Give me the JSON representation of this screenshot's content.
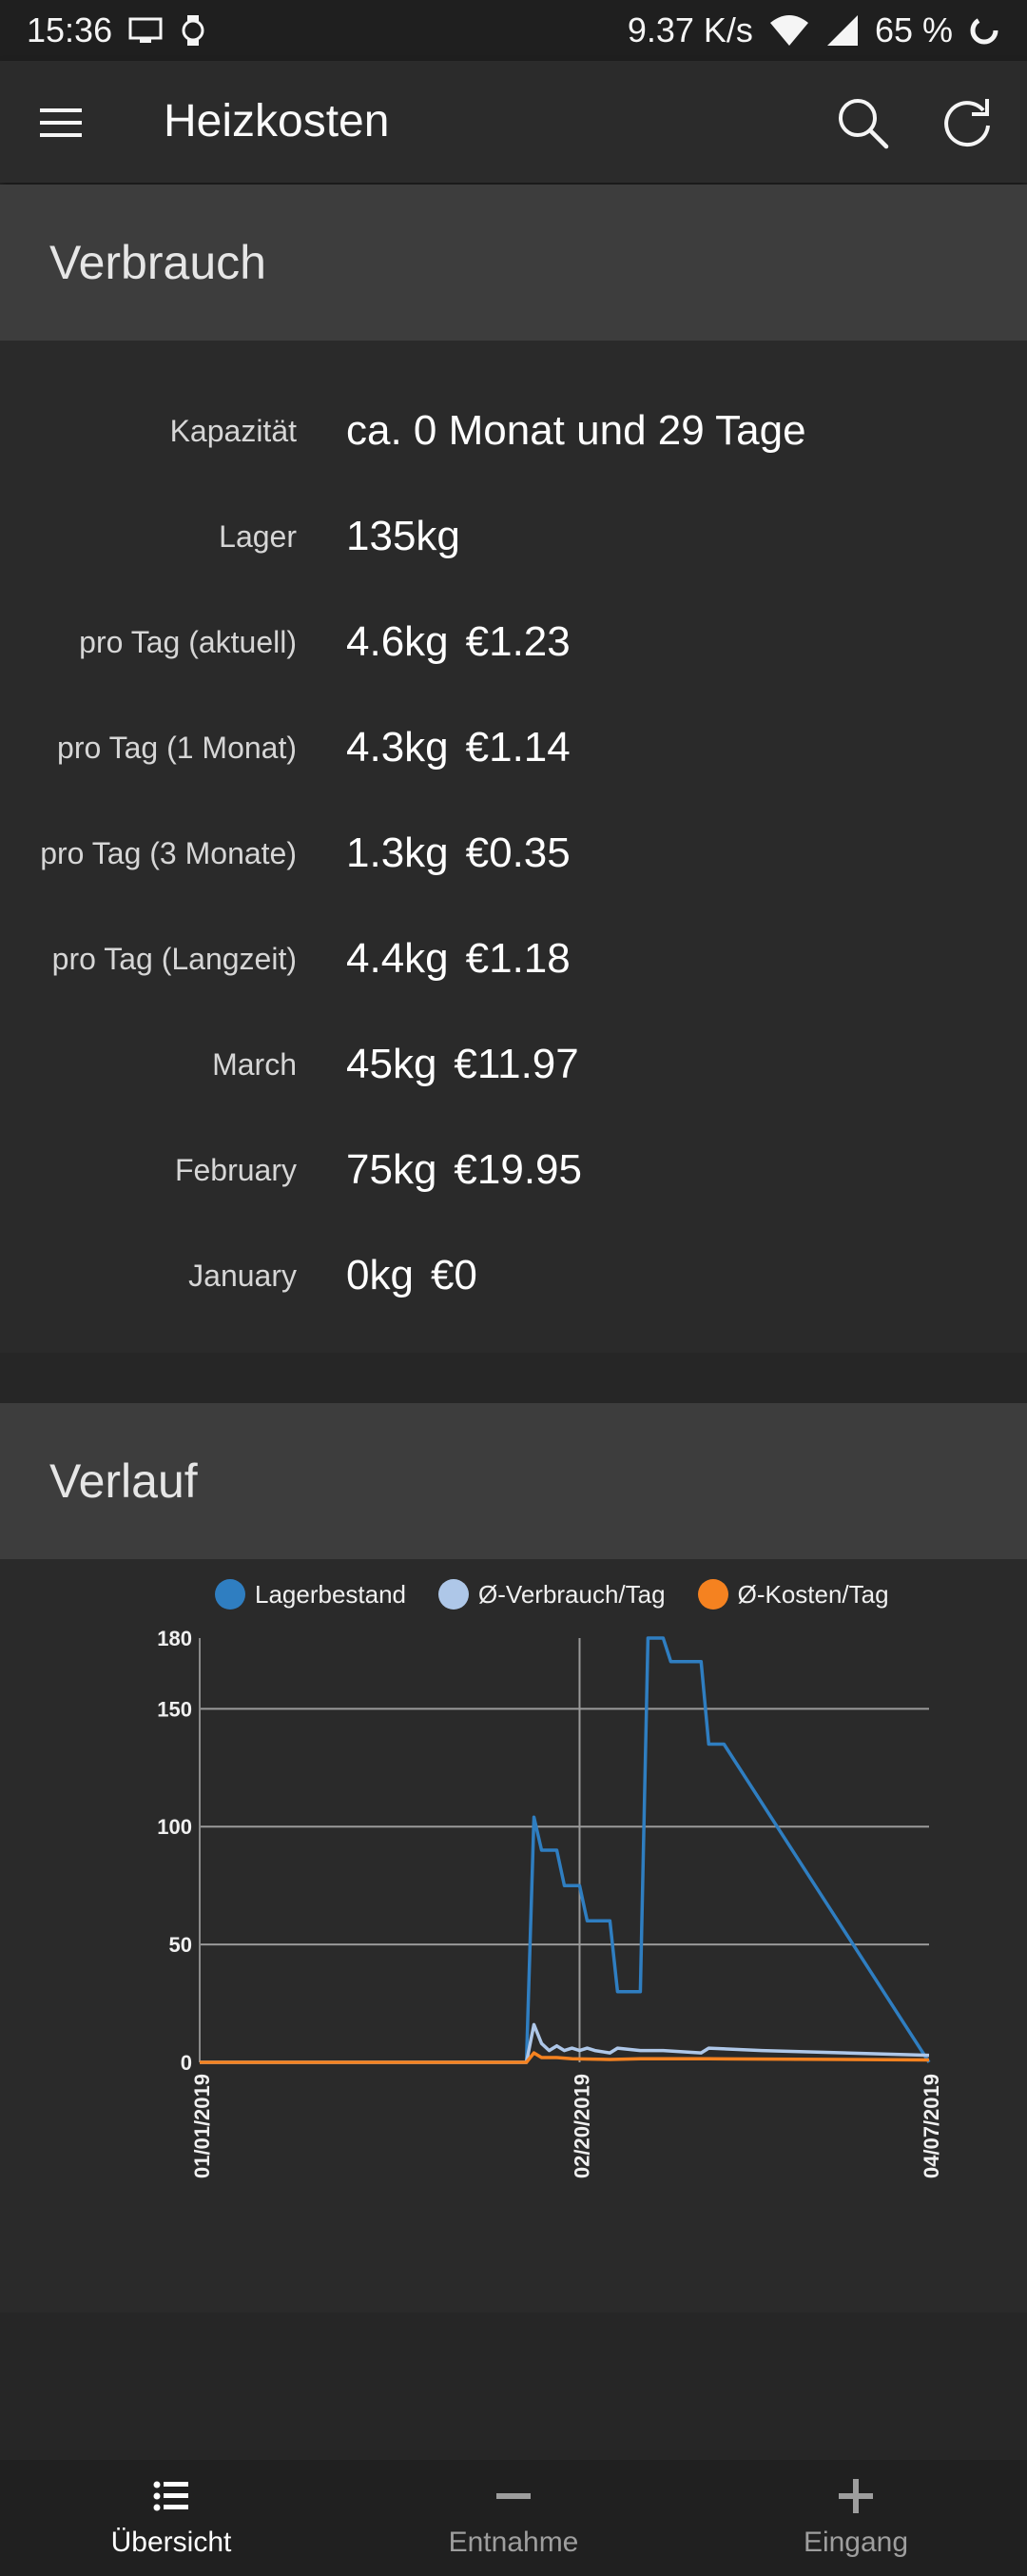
{
  "status_bar": {
    "time": "15:36",
    "speed": "9.37 K/s",
    "battery": "65 %"
  },
  "app_bar": {
    "title": "Heizkosten",
    "icons": [
      "menu-icon",
      "search-icon",
      "refresh-icon"
    ]
  },
  "verbrauch": {
    "title": "Verbrauch",
    "rows": [
      {
        "label": "Kapazität",
        "values": [
          "ca. 0 Monat und 29 Tage"
        ]
      },
      {
        "label": "Lager",
        "values": [
          "135kg"
        ]
      },
      {
        "label": "pro Tag (aktuell)",
        "values": [
          "4.6kg",
          "€1.23"
        ]
      },
      {
        "label": "pro Tag (1 Monat)",
        "values": [
          "4.3kg",
          "€1.14"
        ]
      },
      {
        "label": "pro Tag (3 Monate)",
        "values": [
          "1.3kg",
          "€0.35"
        ]
      },
      {
        "label": "pro Tag (Langzeit)",
        "values": [
          "4.4kg",
          "€1.18"
        ]
      },
      {
        "label": "March",
        "values": [
          "45kg",
          "€11.97"
        ]
      },
      {
        "label": "February",
        "values": [
          "75kg",
          "€19.95"
        ]
      },
      {
        "label": "January",
        "values": [
          "0kg",
          "€0"
        ]
      }
    ]
  },
  "verlauf": {
    "title": "Verlauf"
  },
  "chart_data": {
    "type": "line",
    "title": "",
    "xlabel": "",
    "ylabel": "",
    "ylim": [
      0,
      180
    ],
    "y_ticks": [
      "0",
      "50",
      "100",
      "150",
      "180"
    ],
    "x_ticks": [
      "01/01/2019",
      "02/20/2019",
      "04/07/2019"
    ],
    "grid": true,
    "legend_placement": "top",
    "series": [
      {
        "name": "Lagerbestand",
        "color": "#2f7ec1",
        "points": [
          [
            "2019-01-01",
            0
          ],
          [
            "2019-02-13",
            0
          ],
          [
            "2019-02-14",
            104
          ],
          [
            "2019-02-15",
            90
          ],
          [
            "2019-02-17",
            90
          ],
          [
            "2019-02-18",
            75
          ],
          [
            "2019-02-20",
            75
          ],
          [
            "2019-02-21",
            60
          ],
          [
            "2019-02-24",
            60
          ],
          [
            "2019-02-25",
            30
          ],
          [
            "2019-02-28",
            30
          ],
          [
            "2019-03-01",
            180
          ],
          [
            "2019-03-03",
            180
          ],
          [
            "2019-03-04",
            170
          ],
          [
            "2019-03-08",
            170
          ],
          [
            "2019-03-09",
            135
          ],
          [
            "2019-03-11",
            135
          ],
          [
            "2019-04-07",
            0
          ]
        ]
      },
      {
        "name": "Ø-Verbrauch/Tag",
        "color": "#aec7e8",
        "points": [
          [
            "2019-01-01",
            0
          ],
          [
            "2019-02-13",
            0
          ],
          [
            "2019-02-14",
            16
          ],
          [
            "2019-02-15",
            8
          ],
          [
            "2019-02-16",
            5
          ],
          [
            "2019-02-17",
            7
          ],
          [
            "2019-02-18",
            5
          ],
          [
            "2019-02-19",
            6
          ],
          [
            "2019-02-20",
            5
          ],
          [
            "2019-02-21",
            6
          ],
          [
            "2019-02-22",
            5
          ],
          [
            "2019-02-24",
            4
          ],
          [
            "2019-02-25",
            6
          ],
          [
            "2019-02-28",
            5
          ],
          [
            "2019-03-03",
            5
          ],
          [
            "2019-03-08",
            4
          ],
          [
            "2019-03-09",
            6
          ],
          [
            "2019-03-16",
            5
          ],
          [
            "2019-04-07",
            3
          ]
        ]
      },
      {
        "name": "Ø-Kosten/Tag",
        "color": "#f58220",
        "points": [
          [
            "2019-01-01",
            0
          ],
          [
            "2019-02-13",
            0
          ],
          [
            "2019-02-14",
            4
          ],
          [
            "2019-02-15",
            2
          ],
          [
            "2019-02-17",
            2
          ],
          [
            "2019-02-19",
            1.5
          ],
          [
            "2019-02-24",
            1.2
          ],
          [
            "2019-02-28",
            1.5
          ],
          [
            "2019-03-09",
            1.5
          ],
          [
            "2019-04-07",
            1
          ]
        ]
      }
    ]
  },
  "bottom_nav": [
    {
      "label": "Übersicht",
      "icon": "list-icon",
      "active": true
    },
    {
      "label": "Entnahme",
      "icon": "minus-icon",
      "active": false
    },
    {
      "label": "Eingang",
      "icon": "plus-icon",
      "active": false
    }
  ],
  "colors": {
    "background": "#262626",
    "card": "#2a2a2a",
    "section_header": "#3d3d3d",
    "active_nav": "#ffffff",
    "inactive_nav": "#9e9e9e"
  }
}
